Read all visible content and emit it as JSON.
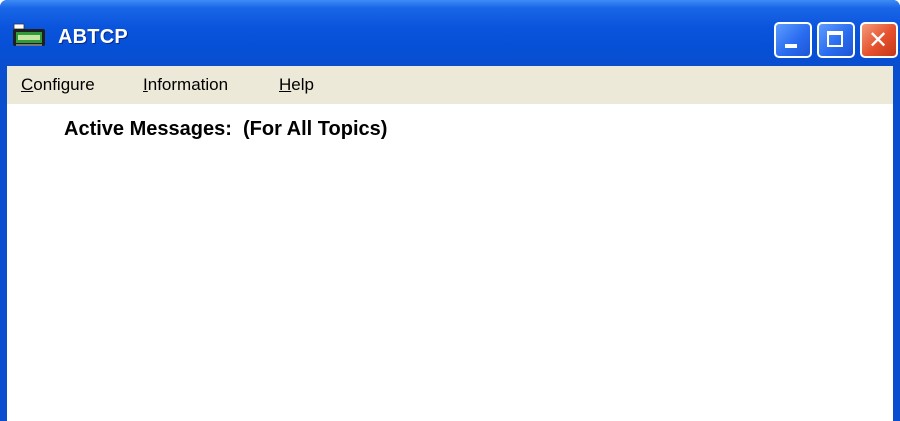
{
  "window": {
    "title": "ABTCP",
    "icon": "abtcp-app-icon",
    "buttons": {
      "minimize": "minimize-icon",
      "maximize": "maximize-icon",
      "close": "close-icon"
    }
  },
  "menu": {
    "items": [
      {
        "label": "Configure",
        "mnemonic": "C",
        "rest": "onfigure"
      },
      {
        "label": "Information",
        "mnemonic": "I",
        "rest": "nformation"
      },
      {
        "label": "Help",
        "mnemonic": "H",
        "rest": "elp"
      }
    ]
  },
  "content": {
    "heading": "Active Messages:  (For All Topics)"
  },
  "colors": {
    "titlebar": "#0a55dc",
    "menubar": "#ece9d8",
    "client": "#ffffff",
    "close_button": "#e5502c"
  }
}
